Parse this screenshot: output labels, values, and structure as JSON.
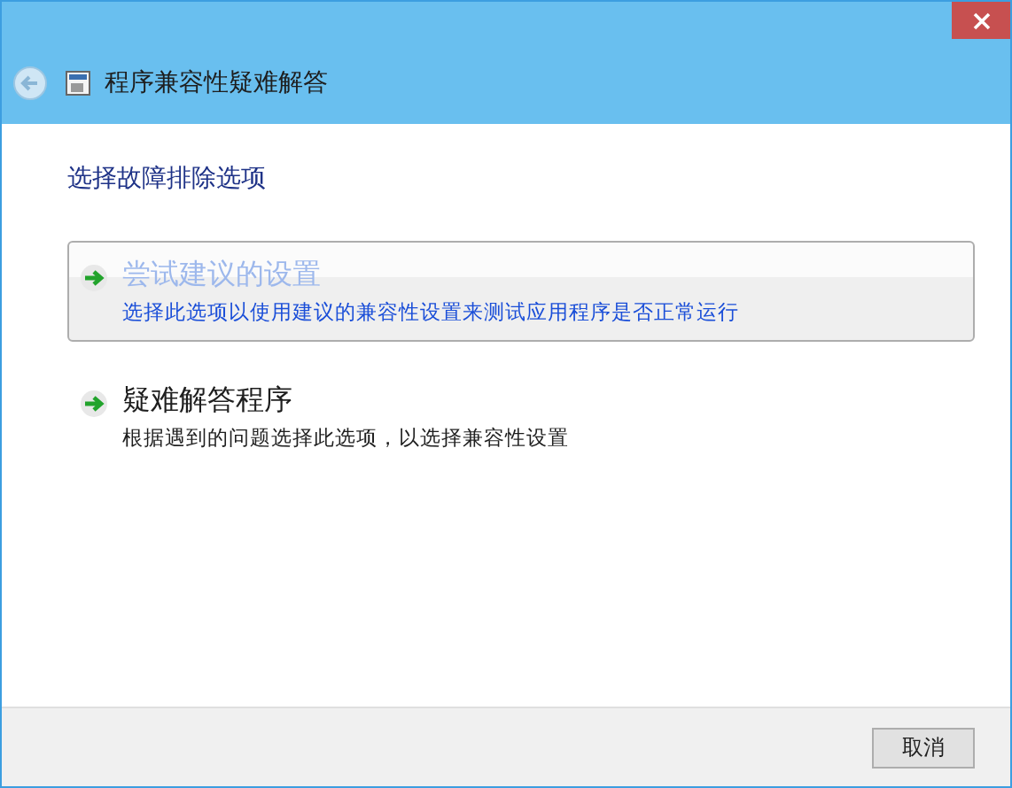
{
  "window": {
    "title": "程序兼容性疑难解答"
  },
  "heading": "选择故障排除选项",
  "options": [
    {
      "title": "尝试建议的设置",
      "description": "选择此选项以使用建议的兼容性设置来测试应用程序是否正常运行",
      "selected": true
    },
    {
      "title": "疑难解答程序",
      "description": "根据遇到的问题选择此选项，以选择兼容性设置",
      "selected": false
    }
  ],
  "buttons": [
    "取消"
  ]
}
